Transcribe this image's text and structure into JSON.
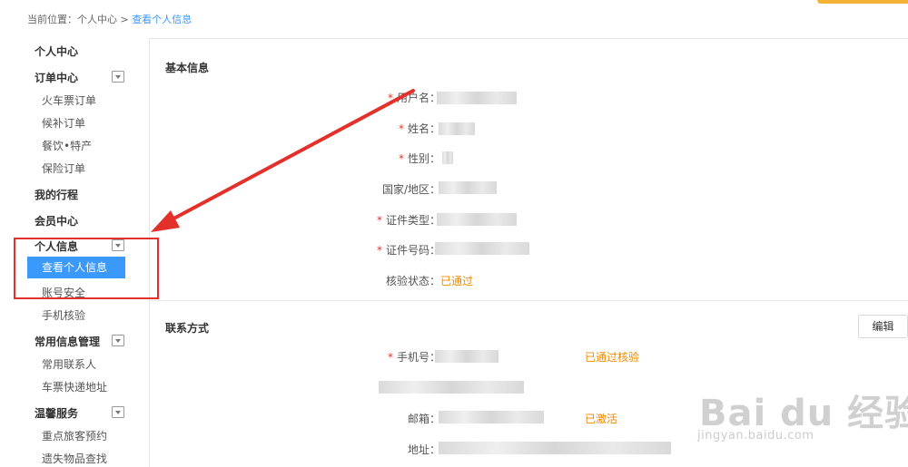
{
  "breadcrumb": {
    "prefix": "当前位置：个人中心 > ",
    "current": "查看个人信息"
  },
  "sidebar": {
    "personal_center": "个人中心",
    "order_center": "订单中心",
    "train_orders": "火车票订单",
    "waitlist_orders": "候补订单",
    "catering": "餐饮•特产",
    "insurance_orders": "保险订单",
    "my_trips": "我的行程",
    "member_center": "会员中心",
    "personal_info": "个人信息",
    "view_personal_info": "查看个人信息",
    "account_security": "账号安全",
    "phone_verify": "手机核验",
    "common_info": "常用信息管理",
    "common_contacts": "常用联系人",
    "ticket_address": "车票快递地址",
    "warm_service": "温馨服务",
    "priority_booking": "重点旅客预约",
    "lost_found": "遗失物品查找"
  },
  "basic_info": {
    "title": "基本信息",
    "username_label": "用户名：",
    "name_label": "姓名：",
    "gender_label": "性别：",
    "country_label": "国家/地区：",
    "id_type_label": "证件类型：",
    "id_number_label": "证件号码：",
    "verify_status_label": "核验状态：",
    "verify_status_value": "已通过"
  },
  "contact": {
    "title": "联系方式",
    "edit_label": "编辑",
    "phone_label": "手机号：",
    "phone_status": "已通过核验",
    "email_label": "邮箱：",
    "email_status": "已激活",
    "address_label": "地址："
  },
  "watermark": {
    "logo": "Bai du 经验",
    "site": "jingyan.baidu.com"
  },
  "colors": {
    "accent_blue": "#3b99fc",
    "status_orange": "#f08a00",
    "annotation_red": "#e4302b"
  }
}
